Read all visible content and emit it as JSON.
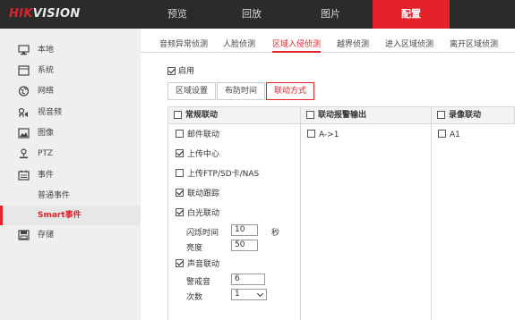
{
  "brand": {
    "hik": "HIK",
    "vision": "VISION"
  },
  "topnav": [
    {
      "label": "预览"
    },
    {
      "label": "回放"
    },
    {
      "label": "图片"
    },
    {
      "label": "配置"
    }
  ],
  "sidebar": {
    "items": [
      {
        "label": "本地",
        "icon": "monitor-icon"
      },
      {
        "label": "系统",
        "icon": "system-icon"
      },
      {
        "label": "网络",
        "icon": "globe-icon"
      },
      {
        "label": "视音频",
        "icon": "av-icon"
      },
      {
        "label": "图像",
        "icon": "image-icon"
      },
      {
        "label": "PTZ",
        "icon": "ptz-icon"
      },
      {
        "label": "事件",
        "icon": "calendar-icon"
      }
    ],
    "subitems": [
      {
        "label": "普通事件"
      },
      {
        "label": "Smart事件"
      }
    ],
    "storage": {
      "label": "存储",
      "icon": "storage-icon"
    }
  },
  "subtabs": [
    "音频异常侦测",
    "人脸侦测",
    "区域入侵侦测",
    "越界侦测",
    "进入区域侦测",
    "离开区域侦测"
  ],
  "enable": {
    "label": "启用",
    "checked": true
  },
  "steps": [
    "区域设置",
    "布防时间",
    "联动方式"
  ],
  "columns": {
    "normal": {
      "title": "常规联动"
    },
    "alarm_out": {
      "title": "联动报警输出",
      "option": "A->1"
    },
    "record": {
      "title": "录像联动",
      "option": "A1"
    }
  },
  "normal_options": {
    "email": "邮件联动",
    "upload_center": "上传中心",
    "upload_ftp": "上传FTP/SD卡/NAS",
    "tracking": "联动跟踪",
    "white_light": "白光联动",
    "flash_time_label": "闪烁时间",
    "flash_time_value": "10",
    "flash_time_unit": "秒",
    "brightness_label": "亮度",
    "brightness_value": "50",
    "audio": "声音联动",
    "alarm_sound_label": "警戒音",
    "alarm_sound_value": "6",
    "count_label": "次数",
    "count_value": "1"
  }
}
